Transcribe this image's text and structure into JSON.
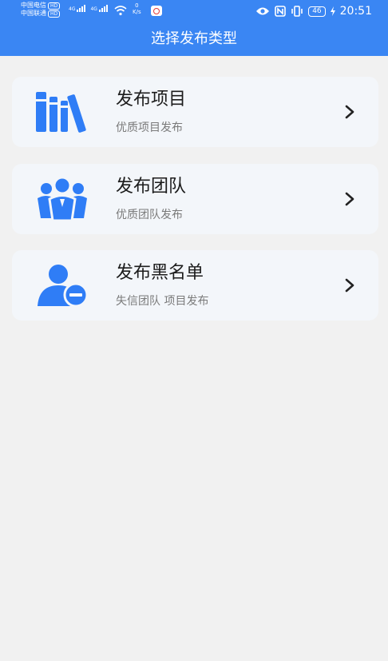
{
  "status_bar": {
    "carrier1": "中国电信",
    "carrier2": "中国联通",
    "hd": "HD",
    "net1": "4G",
    "net2": "4G",
    "speed_value": "0",
    "speed_unit": "K/s",
    "battery": "46",
    "time": "20:51"
  },
  "header": {
    "title": "选择发布类型",
    "color": "#3a86f3"
  },
  "cards": [
    {
      "title": "发布项目",
      "subtitle": "优质项目发布",
      "icon": "books-icon"
    },
    {
      "title": "发布团队",
      "subtitle": "优质团队发布",
      "icon": "team-icon"
    },
    {
      "title": "发布黑名单",
      "subtitle": "失信团队 项目发布",
      "icon": "user-remove-icon"
    }
  ],
  "accent": "#2f7df6"
}
